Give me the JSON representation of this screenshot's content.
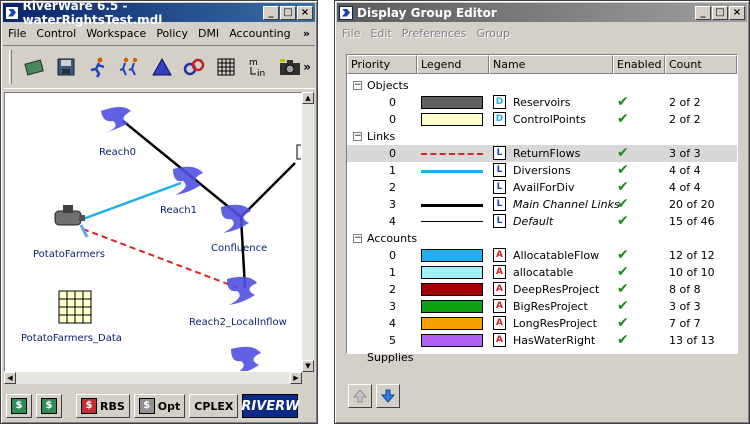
{
  "riverware": {
    "title": "RiverWare 6.5 - waterRightsTest.mdl",
    "menu": [
      "File",
      "Control",
      "Workspace",
      "Policy",
      "DMI",
      "Accounting"
    ],
    "menu_more": "»",
    "toolbar_icons": [
      "run-icon",
      "save-icon",
      "runner-icon",
      "runners-icon",
      "triangle-icon",
      "link-icon",
      "grid-icon",
      "in-icon",
      "camera-icon"
    ],
    "toolbar_more": "»",
    "nodes": {
      "reach0": "Reach0",
      "reach1": "Reach1",
      "confluence": "Confluence",
      "potato_farmers": "PotatoFarmers",
      "potato_farmers_data": "PotatoFarmers_Data",
      "reach2": "Reach2_LocalInflow"
    },
    "bottom": {
      "dollar1": "$",
      "dollar2": "$",
      "rbs": "RBS",
      "opt": "Opt",
      "cplex": "CPLEX",
      "logo": "RIVERW"
    }
  },
  "dge": {
    "title": "Display Group Editor",
    "menu": [
      "File",
      "Edit",
      "Preferences",
      "Group"
    ],
    "columns": [
      "Priority",
      "Legend",
      "Name",
      "Enabled",
      "Count"
    ],
    "groups": [
      {
        "label": "Objects",
        "rows": [
          {
            "priority": "0",
            "legend_color": "#5f5f5f",
            "legend_type": "box",
            "icon": "D",
            "icon_color": "#20b0e0",
            "name": "Reservoirs",
            "italic": false,
            "count": "2 of 2"
          },
          {
            "priority": "0",
            "legend_color": "#ffffcc",
            "legend_type": "box",
            "icon": "D",
            "icon_color": "#20b0e0",
            "name": "ControlPoints",
            "italic": false,
            "count": "2 of 2"
          }
        ]
      },
      {
        "label": "Links",
        "rows": [
          {
            "priority": "0",
            "legend_color": "#e02020",
            "legend_type": "dash",
            "icon": "L",
            "icon_color": "#2040c0",
            "name": "ReturnFlows",
            "italic": false,
            "count": "3 of 3",
            "selected": true
          },
          {
            "priority": "1",
            "legend_color": "#20b0f0",
            "legend_type": "line-thick",
            "icon": "L",
            "icon_color": "#2040c0",
            "name": "Diversions",
            "italic": false,
            "count": "4 of 4"
          },
          {
            "priority": "2",
            "legend_color": "",
            "legend_type": "none",
            "icon": "L",
            "icon_color": "#2040c0",
            "name": "AvailForDiv",
            "italic": false,
            "count": "4 of 4"
          },
          {
            "priority": "3",
            "legend_color": "#000000",
            "legend_type": "line-thick",
            "icon": "L",
            "icon_color": "#2040c0",
            "name": "Main Channel Links",
            "italic": true,
            "count": "20 of 20"
          },
          {
            "priority": "4",
            "legend_color": "#000000",
            "legend_type": "line-thin",
            "icon": "L",
            "icon_color": "#2040c0",
            "name": "Default",
            "italic": true,
            "count": "15 of 46"
          }
        ]
      },
      {
        "label": "Accounts",
        "rows": [
          {
            "priority": "0",
            "legend_color": "#20b0f0",
            "legend_type": "box",
            "icon": "A",
            "icon_color": "#d02020",
            "name": "AllocatableFlow",
            "italic": false,
            "count": "12 of 12"
          },
          {
            "priority": "1",
            "legend_color": "#a0f0f8",
            "legend_type": "box",
            "icon": "A",
            "icon_color": "#d02020",
            "name": "allocatable",
            "italic": false,
            "count": "10 of 10"
          },
          {
            "priority": "2",
            "legend_color": "#a00000",
            "legend_type": "box",
            "icon": "A",
            "icon_color": "#d02020",
            "name": "DeepResProject",
            "italic": false,
            "count": "8 of 8"
          },
          {
            "priority": "3",
            "legend_color": "#10a010",
            "legend_type": "box",
            "icon": "A",
            "icon_color": "#d02020",
            "name": "BigResProject",
            "italic": false,
            "count": "3 of 3"
          },
          {
            "priority": "4",
            "legend_color": "#f8a000",
            "legend_type": "box",
            "icon": "A",
            "icon_color": "#d02020",
            "name": "LongResProject",
            "italic": false,
            "count": "7 of 7"
          },
          {
            "priority": "5",
            "legend_color": "#b060f0",
            "legend_type": "box",
            "icon": "A",
            "icon_color": "#d02020",
            "name": "HasWaterRight",
            "italic": false,
            "count": "13 of 13"
          }
        ]
      },
      {
        "label": "Supplies",
        "rows": []
      }
    ],
    "check_glyph": "✔",
    "expand_glyph": "−"
  }
}
